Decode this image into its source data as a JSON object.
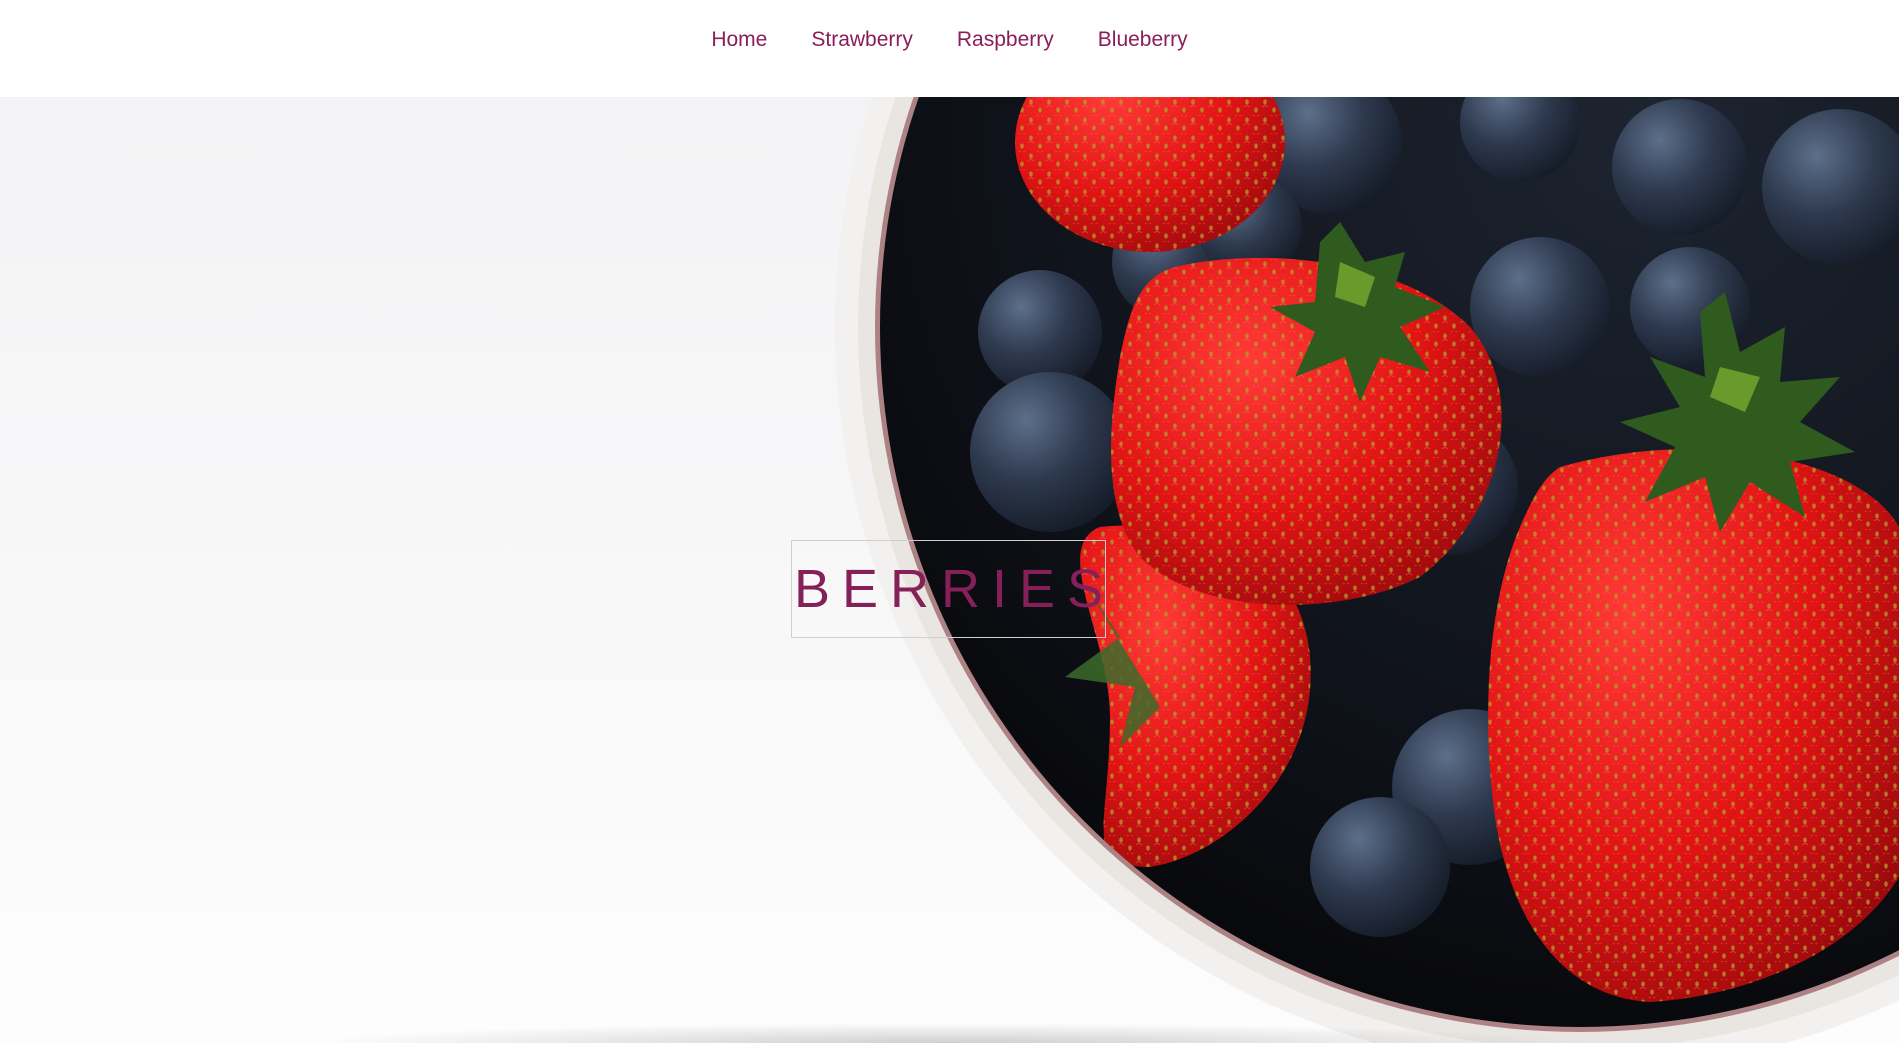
{
  "nav": {
    "items": [
      {
        "label": "Home"
      },
      {
        "label": "Strawberry"
      },
      {
        "label": "Raspberry"
      },
      {
        "label": "Blueberry"
      }
    ]
  },
  "hero": {
    "title": "BERRIES",
    "image": "bowl-of-strawberries-and-blueberries"
  },
  "colors": {
    "accent": "#8a1d5b",
    "nav_bg": "#ffffff",
    "hero_bg": "#f5f5f7",
    "title_border": "#cfcfcf"
  }
}
